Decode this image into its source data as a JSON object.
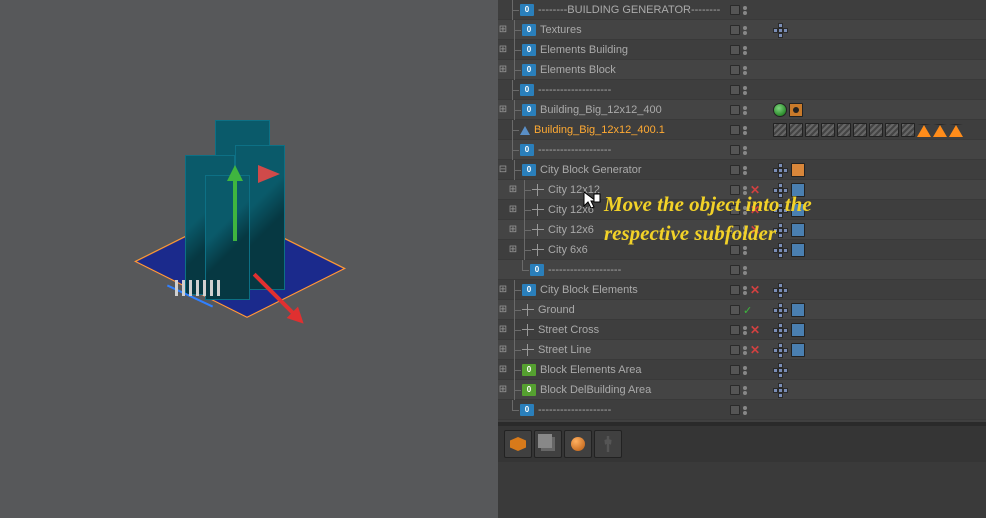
{
  "annotation": "Move the object into the respective subfolder",
  "tree": {
    "r0": "--------BUILDING GENERATOR--------",
    "r1": "Textures",
    "r2": "Elements Building",
    "r3": "Elements Block",
    "r4": "--------------------",
    "r5": "Building_Big_12x12_400",
    "r6": "Building_Big_12x12_400.1",
    "r7": "--------------------",
    "r8": "City Block Generator",
    "r9": "City 12x12",
    "r10": "City 12x6",
    "r11": "City 12x6",
    "r12": "City 6x6",
    "r13": "--------------------",
    "r14": "City Block Elements",
    "r15": "Ground",
    "r16": "Street Cross",
    "r17": "Street Line",
    "r18": "Block Elements Area",
    "r19": "Block DelBuilding Area",
    "r20": "--------------------"
  },
  "layer_label": "0"
}
